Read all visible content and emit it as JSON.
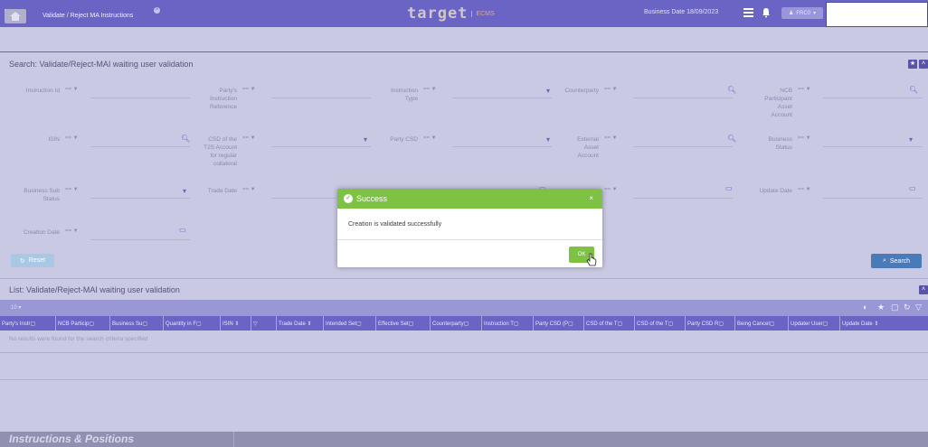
{
  "header": {
    "logo_main": "target",
    "logo_sub": "ECMS",
    "business_date": "Business Date 18/09/2023",
    "user": "FRC0"
  },
  "tabs": [
    {
      "label": "Validate / Reject MA Instructions"
    }
  ],
  "search": {
    "title": "Search: Validate/Reject-MAI waiting user validation",
    "operator": "== ▼",
    "fields": [
      [
        "Instruction Id"
      ],
      [
        "Party's",
        "Instruction",
        "Reference"
      ],
      [
        "Instruction",
        "Type"
      ],
      [
        "Counterparty"
      ],
      [
        "NCB",
        "Participant",
        "Asset",
        "Account"
      ],
      [
        "ISIN"
      ],
      [
        "CSD of the",
        "T2S Account",
        "for regular",
        "collateral"
      ],
      [
        "Party CSD"
      ],
      [
        "External",
        "Asset",
        "Account"
      ],
      [
        "Business",
        "Status"
      ],
      [
        "Business Sub",
        "Status"
      ],
      [
        "Trade Date"
      ],
      [
        "Update Date"
      ],
      [
        "Creation Date"
      ]
    ],
    "partial_labels": [
      "te",
      "ent",
      "ate"
    ],
    "reset_label": "Reset",
    "search_label": "Search"
  },
  "list": {
    "title": "List: Validate/Reject-MAI waiting user validation",
    "columns": [
      "Party's Instr▢",
      "NCB Particip▢",
      "Business Su▢",
      "Quantity in F▢",
      "ISIN ⇕",
      "▽",
      "Trade Date ⇕",
      "Intended Set▢",
      "Effective Set▢",
      "Counterparty▢",
      "Instruction T▢",
      "Party CSD (P▢",
      "CSD of the T▢",
      "CSD of the T▢",
      "Party CSD R▢",
      "Being Cancel▢",
      "Updater User▢",
      "Update Date ⇕"
    ],
    "no_results": "No results were found for the search criteria specified"
  },
  "footer": {
    "title": "Instructions & Positions"
  },
  "modal": {
    "title": "Success",
    "message": "Creation is validated successfully",
    "ok_label": "OK",
    "close_glyph": "×"
  },
  "colors": {
    "primary": "#6a64c4",
    "success": "#7dc242",
    "background": "#c9c9e3"
  }
}
